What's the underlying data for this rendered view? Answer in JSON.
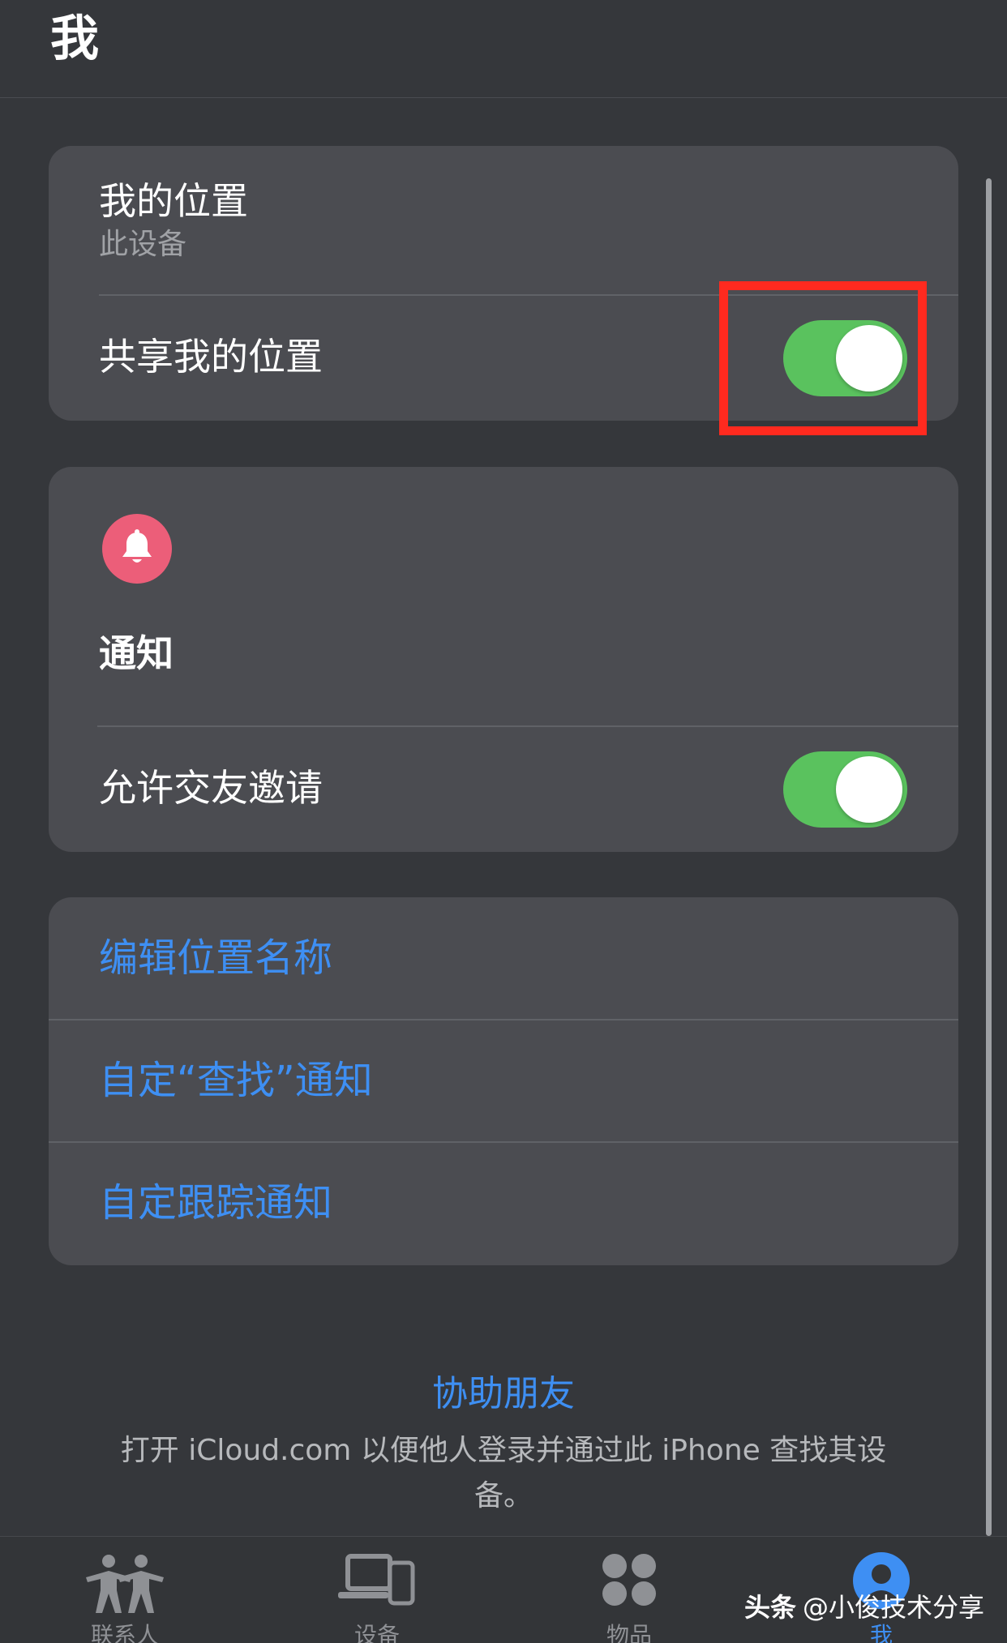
{
  "header": {
    "title": "我"
  },
  "location_card": {
    "title": "我的位置",
    "subtitle": "此设备",
    "share_label": "共享我的位置",
    "share_enabled": true
  },
  "notifications_card": {
    "icon": "bell-icon",
    "icon_color": "#ec5e79",
    "title": "通知",
    "friend_requests_label": "允许交友邀请",
    "friend_requests_enabled": true
  },
  "actions": {
    "edit_location_name": "编辑位置名称",
    "customize_find_notifications": "自定“查找”通知",
    "customize_tracking_notifications": "自定跟踪通知"
  },
  "footer": {
    "link": "协助朋友",
    "description": "打开 iCloud.com 以便他人登录并通过此 iPhone 查找其设备。"
  },
  "tabbar": {
    "tabs": [
      {
        "label": "联系人",
        "icon": "people-icon"
      },
      {
        "label": "设备",
        "icon": "devices-icon"
      },
      {
        "label": "物品",
        "icon": "items-icon"
      },
      {
        "label": "我",
        "icon": "person-circle-icon",
        "active": true
      }
    ]
  },
  "watermark": {
    "brand": "头条",
    "handle": "@小俊技术分享"
  },
  "colors": {
    "accent": "#3e8ff3",
    "toggle_on": "#5ac25e",
    "highlight": "#ff2a1f"
  }
}
